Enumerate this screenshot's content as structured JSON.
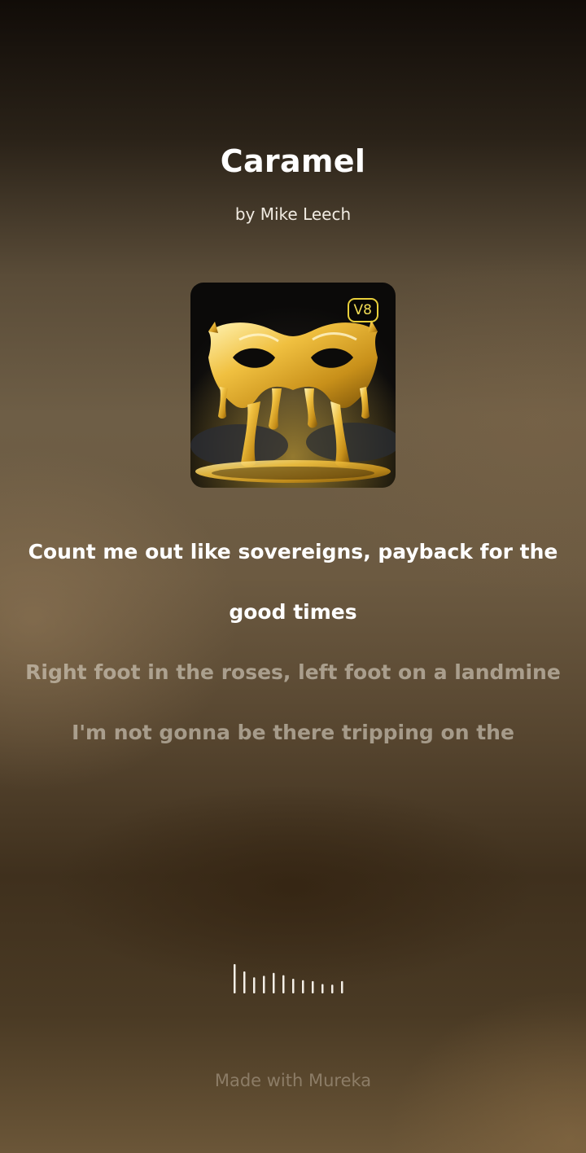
{
  "song": {
    "title": "Caramel",
    "artist_line": "by Mike Leech",
    "cover": {
      "badge": "V8",
      "badge_color": "#e8cf3a",
      "art_icon": "golden-masquerade-mask"
    }
  },
  "lyrics": {
    "active_line": "Count me out like sovereigns, payback for the good times",
    "next_line_1": "Right foot in the roses, left foot on a landmine",
    "next_line_2": "I'm not gonna be there tripping on the"
  },
  "visualizer": {
    "icon": "audio-waveform-icon",
    "levels": [
      1.0,
      0.75,
      0.55,
      0.6,
      0.7,
      0.62,
      0.5,
      0.45,
      0.42,
      0.32,
      0.3,
      0.42
    ]
  },
  "footer": {
    "credit": "Made with Mureka"
  },
  "colors": {
    "accent_badge": "#e8cf3a",
    "text_primary": "#ffffff",
    "text_dim": "#b8ab98"
  }
}
